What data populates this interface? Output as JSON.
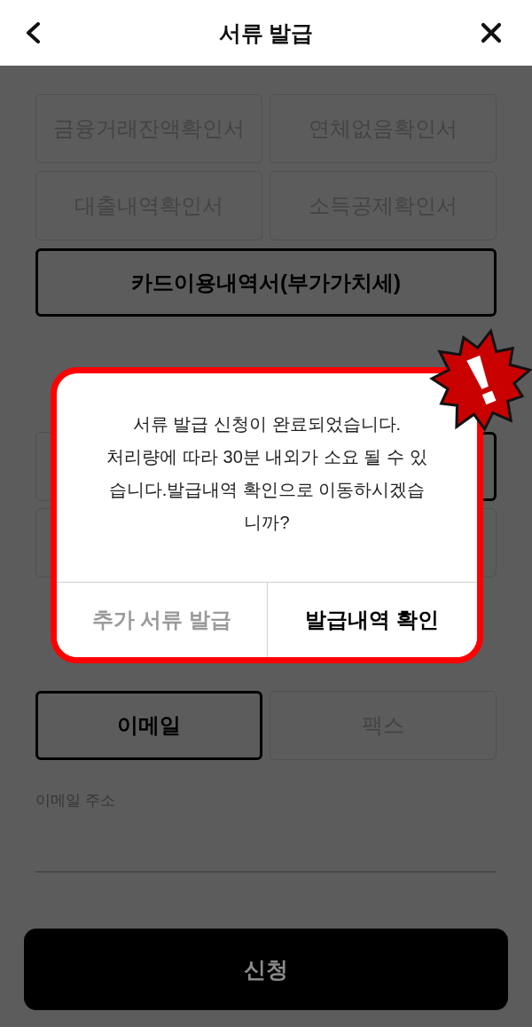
{
  "header": {
    "title": "서류 발급"
  },
  "documents": [
    {
      "label": "금융거래잔액확인서",
      "selected": false,
      "kind": "half"
    },
    {
      "label": "연체없음확인서",
      "selected": false,
      "kind": "half"
    },
    {
      "label": "대출내역확인서",
      "selected": false,
      "kind": "half"
    },
    {
      "label": "소득공제확인서",
      "selected": false,
      "kind": "half"
    },
    {
      "label": "카드이용내역서(부가가치세)",
      "selected": true,
      "kind": "wide"
    }
  ],
  "options_behind_dialog": [
    {
      "selected": false
    },
    {
      "selected": true
    },
    {
      "selected": false
    },
    {
      "selected": false
    }
  ],
  "delivery_methods": [
    {
      "label": "이메일",
      "selected": true
    },
    {
      "label": "팩스",
      "selected": false
    }
  ],
  "email_field": {
    "label": "이메일 주소"
  },
  "submit_button": {
    "label": "신청"
  },
  "dialog": {
    "message": "서류 발급 신청이 완료되었습니다.\n처리량에 따라 30분 내외가 소요 될 수 있습니다.발급내역 확인으로 이동하시겠습니까?",
    "buttons": [
      {
        "label": "추가 서류 발급",
        "kind": "secondary"
      },
      {
        "label": "발급내역 확인",
        "kind": "primary"
      }
    ]
  }
}
